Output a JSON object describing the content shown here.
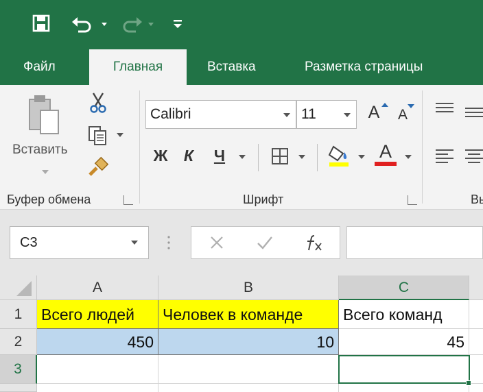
{
  "tabs": [
    {
      "label": "Файл",
      "active": false
    },
    {
      "label": "Главная",
      "active": true
    },
    {
      "label": "Вставка",
      "active": false
    },
    {
      "label": "Разметка страницы",
      "active": false
    }
  ],
  "ribbon": {
    "clipboard": {
      "paste_label": "Вставить",
      "group_label": "Буфер обмена"
    },
    "font": {
      "font_name": "Calibri",
      "font_size": "11",
      "grow_label": "A",
      "shrink_label": "A",
      "bold_label": "Ж",
      "italic_label": "К",
      "underline_label": "Ч",
      "font_color_label": "A",
      "group_label": "Шрифт"
    },
    "next_group_label_partial": "Вь"
  },
  "formula_bar": {
    "name_box": "C3",
    "formula": ""
  },
  "sheet": {
    "columns": [
      "A",
      "B",
      "C"
    ],
    "rows": [
      "1",
      "2",
      "3"
    ],
    "selected_cell": "C3",
    "cells": {
      "A1": "Всего людей",
      "B1": "Человек в команде",
      "C1": "Всего команд",
      "A2": "450",
      "B2": "10",
      "C2": "45"
    }
  },
  "colors": {
    "accent": "#217346",
    "highlight_yellow": "#ffff00",
    "highlight_blue": "#bdd7ee",
    "font_color_bar": "#e02020"
  }
}
